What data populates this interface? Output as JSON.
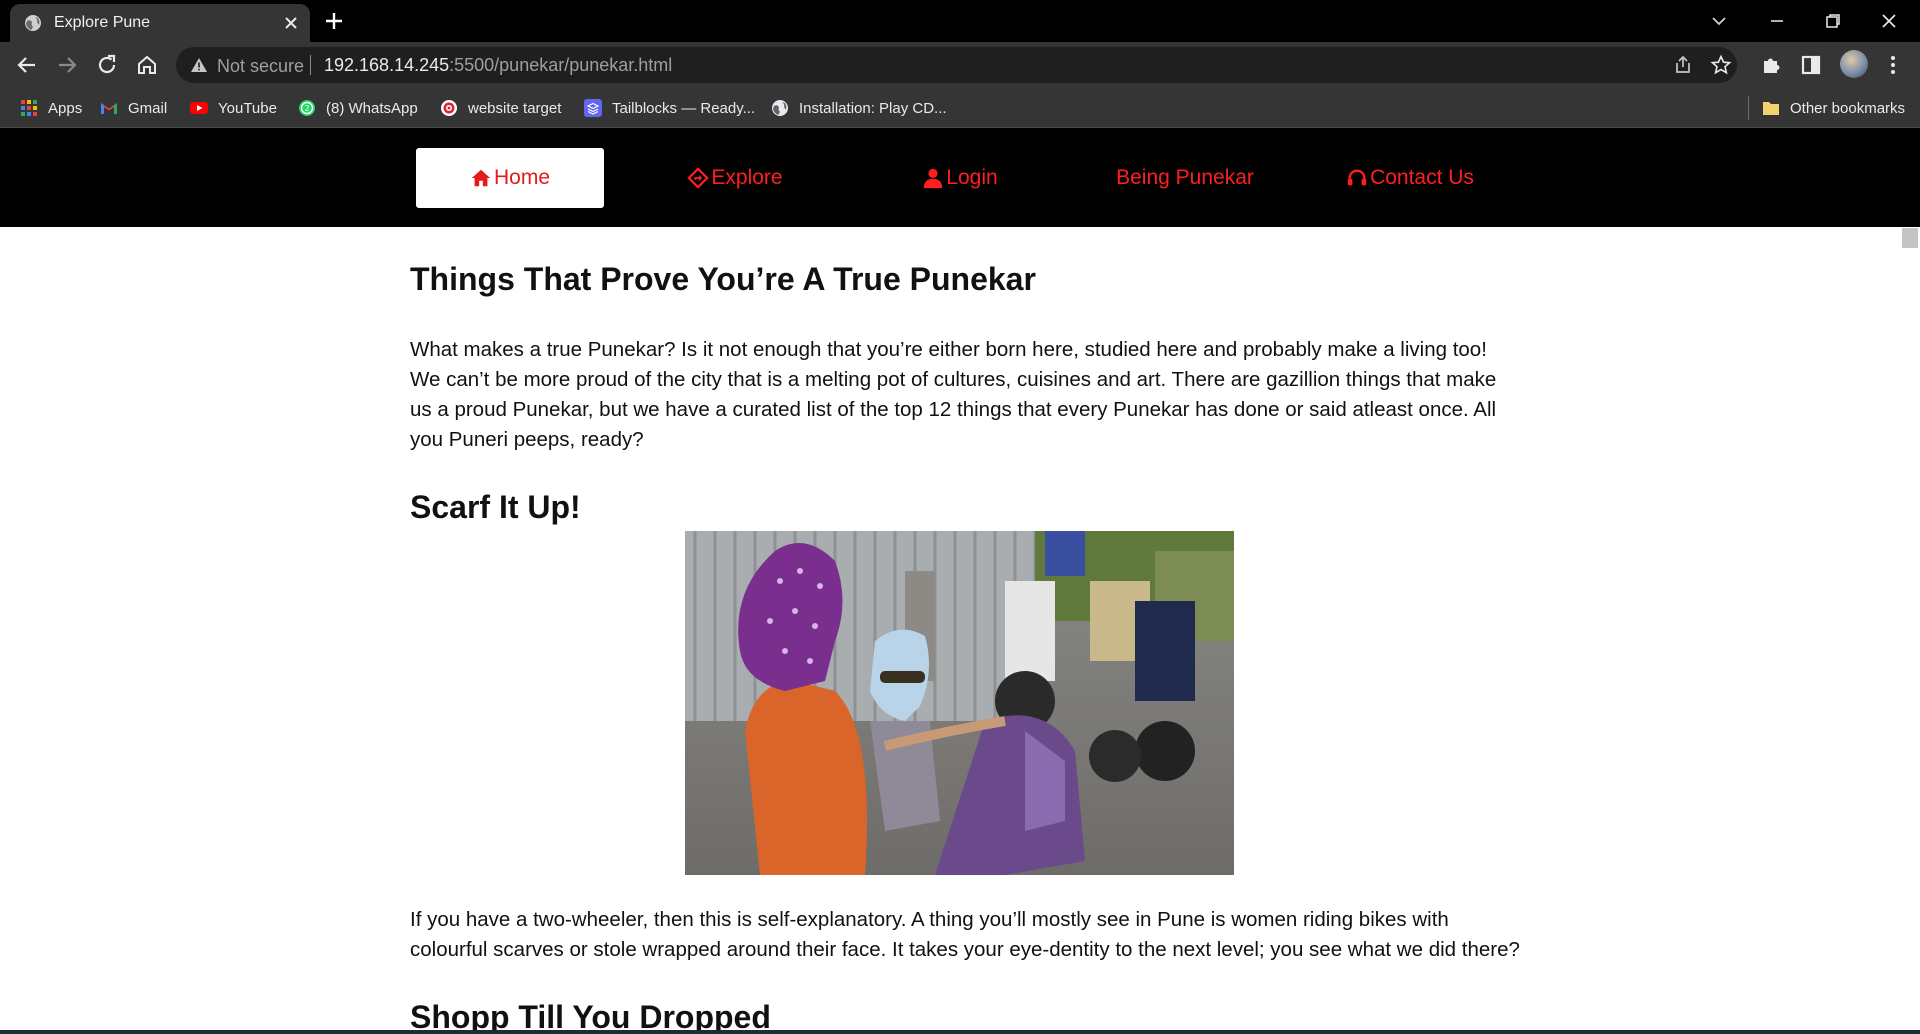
{
  "browser": {
    "tab_title": "Explore Pune",
    "security_label": "Not secure",
    "url_host": "192.168.14.245",
    "url_path": ":5500/punekar/punekar.html"
  },
  "bookmarks": [
    {
      "label": "Apps",
      "icon": "apps-grid-icon"
    },
    {
      "label": "Gmail",
      "icon": "gmail-icon"
    },
    {
      "label": "YouTube",
      "icon": "youtube-icon"
    },
    {
      "label": "(8) WhatsApp",
      "icon": "whatsapp-icon"
    },
    {
      "label": "website target",
      "icon": "target-icon"
    },
    {
      "label": "Tailblocks — Ready...",
      "icon": "tailblocks-icon"
    },
    {
      "label": "Installation: Play CD...",
      "icon": "globe-icon"
    },
    {
      "label": "Other bookmarks",
      "icon": "folder-icon"
    }
  ],
  "nav": {
    "items": [
      {
        "label": "Home",
        "icon": "home-icon",
        "active": true
      },
      {
        "label": "Explore",
        "icon": "directions-icon",
        "active": false
      },
      {
        "label": "Login",
        "icon": "user-icon",
        "active": false
      },
      {
        "label": "Being Punekar",
        "icon": "",
        "active": false
      },
      {
        "label": "Contact Us",
        "icon": "headset-icon",
        "active": false
      }
    ],
    "colors": {
      "background": "#000000",
      "link": "#ff1f1f",
      "active_bg": "#ffffff"
    }
  },
  "article": {
    "title": "Things That Prove You’re A True Punekar",
    "intro": "What makes a true Punekar? Is it not enough that you’re either born here, studied here and probably make a living too! We can’t be more proud of the city that is a melting pot of cultures, cuisines and art. There are gazillion things that make us a proud Punekar, but we have a curated list of the top 12 things that every Punekar has done or said atleast once. All you Puneri peeps, ready?",
    "sections": [
      {
        "heading": "Scarf It Up!",
        "text": "If you have a two-wheeler, then this is self-explanatory. A thing you’ll mostly see in Pune is women riding bikes with colourful scarves or stole wrapped around their face. It takes your eye-dentity to the next level; you see what we did there?"
      },
      {
        "heading": "Shopp Till You Dropped",
        "text": ""
      }
    ]
  }
}
